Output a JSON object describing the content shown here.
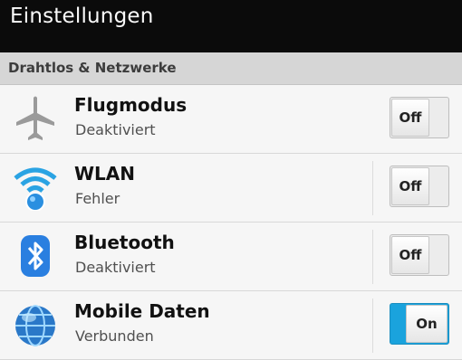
{
  "header": {
    "title": "Einstellungen"
  },
  "section": {
    "label": "Drahtlos & Netzwerke"
  },
  "rows": [
    {
      "icon": "airplane-icon",
      "title": "Flugmodus",
      "status": "Deaktiviert",
      "toggle": "Off"
    },
    {
      "icon": "wifi-icon",
      "title": "WLAN",
      "status": "Fehler",
      "toggle": "Off"
    },
    {
      "icon": "bluetooth-icon",
      "title": "Bluetooth",
      "status": "Deaktiviert",
      "toggle": "Off"
    },
    {
      "icon": "globe-icon",
      "title": "Mobile Daten",
      "status": "Verbunden",
      "toggle": "On"
    }
  ],
  "colors": {
    "toggle_on": "#1aa3dd",
    "title_bar": "#0b0b0b"
  }
}
